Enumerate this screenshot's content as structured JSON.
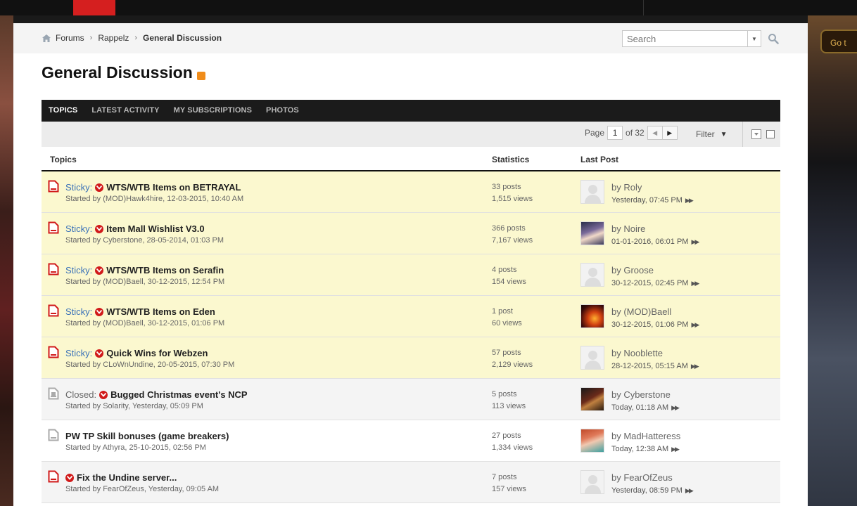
{
  "breadcrumb": {
    "items": [
      "Forums",
      "Rappelz"
    ],
    "current": "General Discussion"
  },
  "search": {
    "placeholder": "Search"
  },
  "page": {
    "title": "General Discussion"
  },
  "tabs": [
    "TOPICS",
    "LATEST ACTIVITY",
    "MY SUBSCRIPTIONS",
    "PHOTOS"
  ],
  "pager": {
    "label": "Page",
    "current": "1",
    "of_label": "of 32"
  },
  "filter": {
    "label": "Filter"
  },
  "columns": {
    "topics": "Topics",
    "statistics": "Statistics",
    "last_post": "Last Post"
  },
  "side": {
    "goto_label": "Go t"
  },
  "colors": {
    "accent_red": "#d11a1a",
    "sticky_bg": "#fbf8cf",
    "tabbar_bg": "#1b1b1b",
    "link_blue": "#3b72b8"
  },
  "topics": [
    {
      "prefix": "Sticky:",
      "title": "WTS/WTB Items on BETRAYAL",
      "started": "Started by (MOD)Hawk4hire, 12-03-2015, 10:40 AM",
      "posts": "33 posts",
      "views": "1,515 views",
      "last_by": "by Roly",
      "last_time": "Yesterday, 07:45 PM",
      "avatar": "default"
    },
    {
      "prefix": "Sticky:",
      "title": "Item Mall Wishlist V3.0",
      "started": "Started by Cyberstone, 28-05-2014, 01:03 PM",
      "posts": "366 posts",
      "views": "7,167 views",
      "last_by": "by Noire",
      "last_time": "01-01-2016, 06:01 PM",
      "avatar": "anime"
    },
    {
      "prefix": "Sticky:",
      "title": "WTS/WTB Items on Serafin",
      "started": "Started by (MOD)Baell, 30-12-2015, 12:54 PM",
      "posts": "4 posts",
      "views": "154 views",
      "last_by": "by Groose",
      "last_time": "30-12-2015, 02:45 PM",
      "avatar": "default"
    },
    {
      "prefix": "Sticky:",
      "title": "WTS/WTB Items on Eden",
      "started": "Started by (MOD)Baell, 30-12-2015, 01:06 PM",
      "posts": "1 post",
      "views": "60 views",
      "last_by": "by (MOD)Baell",
      "last_time": "30-12-2015, 01:06 PM",
      "avatar": "fire"
    },
    {
      "prefix": "Sticky:",
      "title": "Quick Wins for Webzen",
      "started": "Started by CLoWnUndine, 20-05-2015, 07:30 PM",
      "posts": "57 posts",
      "views": "2,129 views",
      "last_by": "by Nooblette",
      "last_time": "28-12-2015, 05:15 AM",
      "avatar": "default"
    },
    {
      "prefix": "Closed:",
      "title": "Bugged Christmas event's NCP",
      "started": "Started by Solarity, Yesterday, 05:09 PM",
      "posts": "5 posts",
      "views": "113 views",
      "last_by": "by Cyberstone",
      "last_time": "Today, 01:18 AM",
      "avatar": "dark"
    },
    {
      "prefix": "",
      "title": "PW TP Skill bonuses (game breakers)",
      "started": "Started by Athyra, 25-10-2015, 02:56 PM",
      "posts": "27 posts",
      "views": "1,334 views",
      "last_by": "by MadHatteress",
      "last_time": "Today, 12:38 AM",
      "avatar": "redhair"
    },
    {
      "prefix": "",
      "title": "Fix the Undine server...",
      "started": "Started by FearOfZeus, Yesterday, 09:05 AM",
      "posts": "7 posts",
      "views": "157 views",
      "last_by": "by FearOfZeus",
      "last_time": "Yesterday, 08:59 PM",
      "avatar": "default"
    }
  ]
}
